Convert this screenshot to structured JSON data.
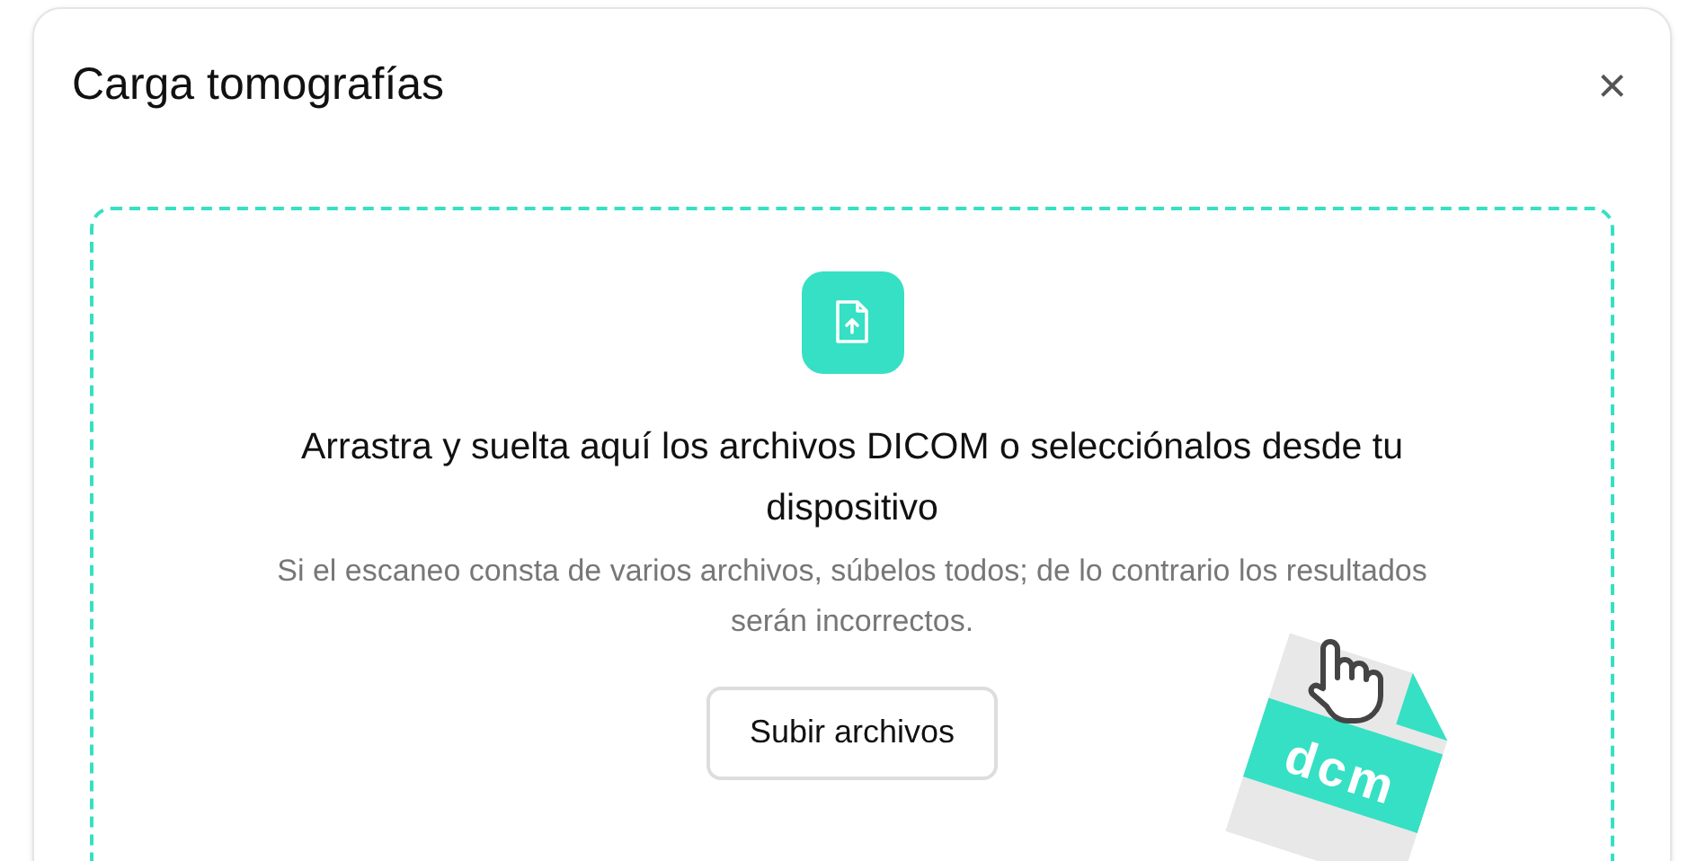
{
  "dialog": {
    "title": "Carga tomografías",
    "close": "×"
  },
  "dropzone": {
    "heading": "Arrastra y suelta aquí los archivos DICOM o selecciónalos desde tu dispositivo",
    "hint": "Si el escaneo consta de varios archivos, súbelos todos; de lo contrario los resultados serán incorrectos.",
    "button": "Subir archivos",
    "file_label": "dcm"
  }
}
